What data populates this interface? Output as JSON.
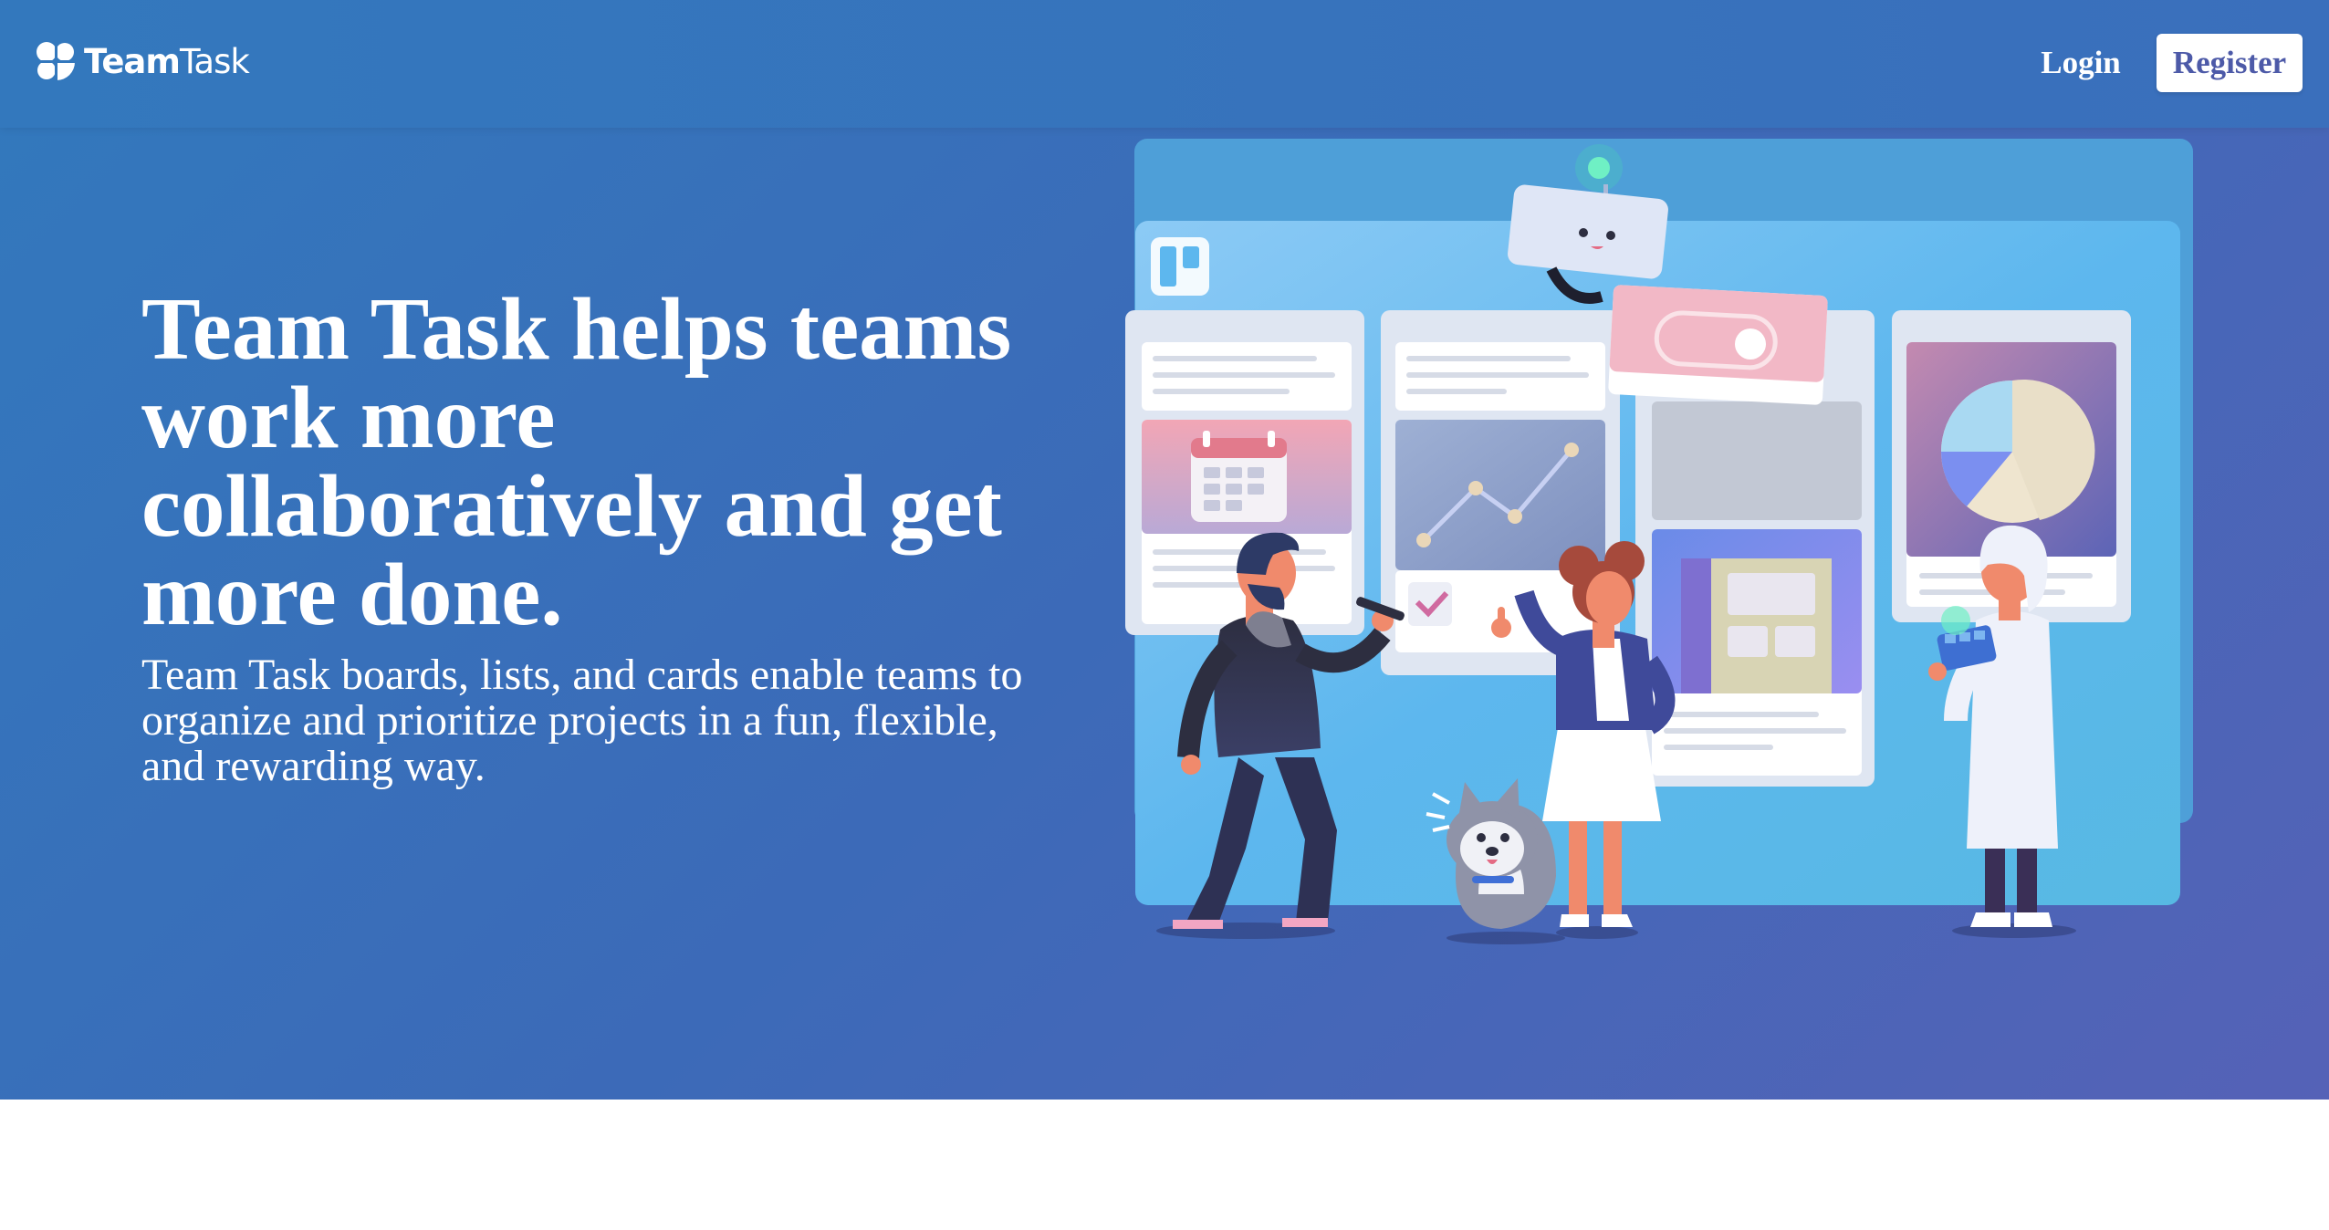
{
  "header": {
    "brand_bold": "Team",
    "brand_light": "Task",
    "login_label": "Login",
    "register_label": "Register"
  },
  "hero": {
    "headline": "Team Task helps teams work more collaboratively and get more done.",
    "subtext": "Team Task boards, lists, and cards enable teams to organize and prioritize projects in a fun, flexible, and rewarding way.",
    "illustration": "team-kanban-board-illustration"
  },
  "colors": {
    "hero_start": "#3279bd",
    "hero_end": "#5562b7",
    "register_text": "#4d5aa8",
    "board": "#5cb6ee"
  }
}
